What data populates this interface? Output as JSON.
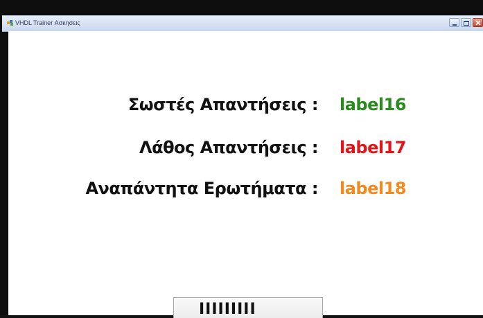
{
  "window": {
    "title": "VHDL Trainer Ασκησεις",
    "buttons": {
      "minimize": "minimize",
      "maximize": "maximize",
      "close": "close"
    }
  },
  "results": {
    "correct": {
      "label": "Σωστές Απαντήσεις :",
      "value": "label16",
      "color": "#2a8a1e"
    },
    "wrong": {
      "label": "Λάθος Απαντήσεις :",
      "value": "label17",
      "color": "#e4141b"
    },
    "unanswered": {
      "label": "Αναπάντητα Ερωτήματα :",
      "value": "label18",
      "color": "#f28a1f"
    }
  },
  "bottom_button": {
    "label": "IIIIIIIII"
  },
  "icons": {
    "app": "app-icon",
    "minimize": "minimize-icon",
    "maximize": "maximize-icon",
    "close": "close-icon"
  }
}
